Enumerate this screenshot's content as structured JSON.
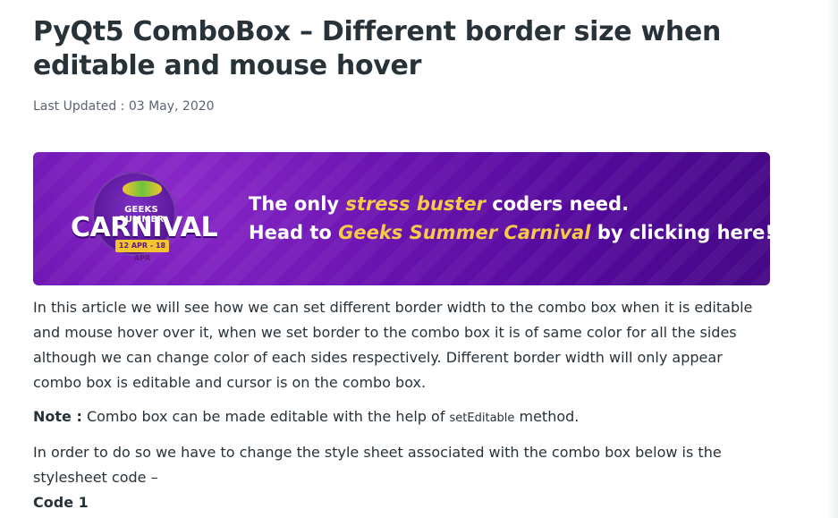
{
  "article": {
    "title": "PyQt5 ComboBox – Different border size when editable and mouse hover",
    "last_updated": "Last Updated : 03 May, 2020"
  },
  "banner": {
    "badge_top": "GEEKS SUMMER",
    "badge_main": "CARNIVAL",
    "badge_dates": "12 APR - 18 APR",
    "line1_pre": "The only ",
    "line1_highlight": "stress buster",
    "line1_post": " coders need.",
    "line2_pre": "Head to ",
    "line2_highlight": "Geeks Summer Carnival",
    "line2_post": " by clicking here!"
  },
  "body": {
    "paragraph1": "In this article we will see how we can set different border width to the combo box when it is editable and mouse hover over it, when we set border to the combo box it is of same color for all the sides although we can change color of each sides respectively. Different border width will only appear combo box is editable and cursor is on the combo box.",
    "note_label": "Note :",
    "note_pre": " Combo box can be made editable with the help of ",
    "note_code": "setEditable",
    "note_post": " method.",
    "paragraph3": "In order to do so we have to change the style sheet associated with the combo box below is the stylesheet code –",
    "code_label": "Code 1"
  },
  "colors": {
    "text": "#273239",
    "muted": "#5b6370",
    "banner_purple": "#6a13b0",
    "banner_highlight": "#f7c948"
  }
}
